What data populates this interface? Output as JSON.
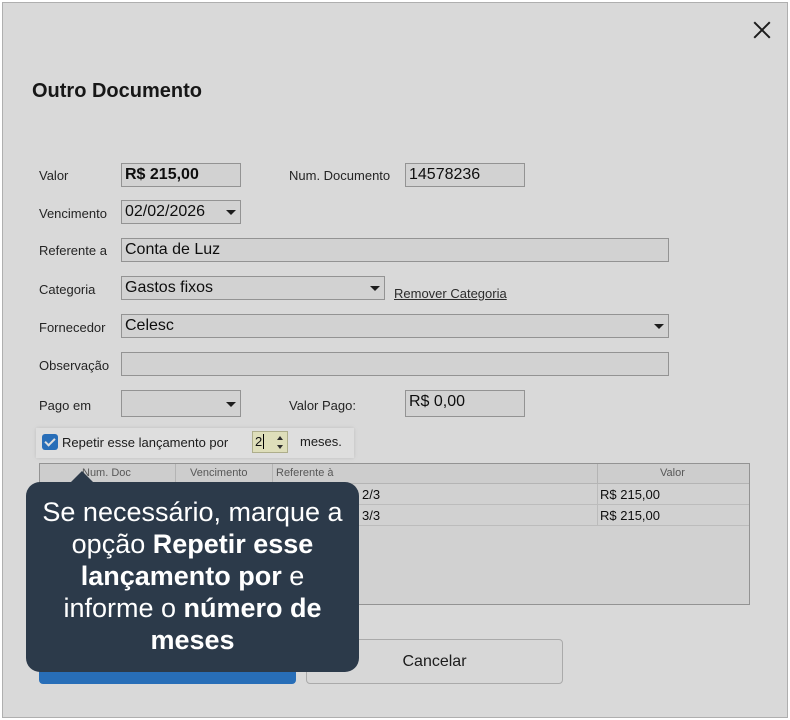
{
  "dialog": {
    "title": "Outro Documento",
    "close_icon": "close-icon"
  },
  "form": {
    "valor_label": "Valor",
    "valor_value": "R$ 215,00",
    "num_doc_label": "Num. Documento",
    "num_doc_value": "14578236",
    "vencimento_label": "Vencimento",
    "vencimento_value": "02/02/2026",
    "referente_label": "Referente a",
    "referente_value": "Conta de Luz",
    "categoria_label": "Categoria",
    "categoria_value": "Gastos fixos",
    "remover_categoria": "Remover Categoria",
    "fornecedor_label": "Fornecedor",
    "fornecedor_value": "Celesc",
    "observacao_label": "Observação",
    "observacao_value": "",
    "pago_em_label": "Pago em",
    "pago_em_value": "",
    "valor_pago_label": "Valor Pago:",
    "valor_pago_value": "R$ 0,00"
  },
  "repeat": {
    "checked": true,
    "label": "Repetir esse lançamento por",
    "value": "2",
    "suffix": "meses."
  },
  "table": {
    "headers": [
      "Num. Doc",
      "Vencimento",
      "Referente à",
      "Valor"
    ],
    "rows": [
      {
        "parcela": "2/3",
        "valor": "R$ 215,00"
      },
      {
        "parcela": "3/3",
        "valor": "R$ 215,00"
      }
    ]
  },
  "buttons": {
    "cancel": "Cancelar"
  },
  "tooltip": {
    "part1": "Se necessário, marque a opção ",
    "bold1": "Repetir esse lançamento por",
    "part2": " e informe o ",
    "bold2": "número de meses"
  },
  "colors": {
    "accent": "#2f7fd4",
    "tooltip_bg": "#2c3a4a"
  }
}
